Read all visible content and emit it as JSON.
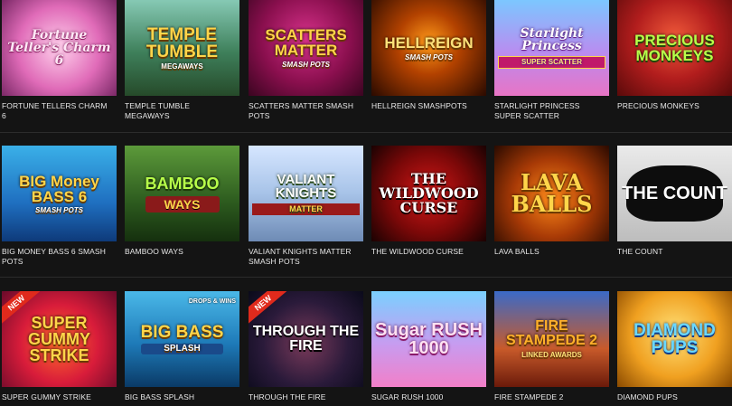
{
  "games": [
    {
      "caption": "FORTUNE TELLERS CHARM 6",
      "art": "Fortune Teller's Charm 6",
      "badge": ""
    },
    {
      "caption": "TEMPLE TUMBLE MEGAWAYS",
      "art": "TEMPLE TUMBLE",
      "art_sub": "MEGAWAYS",
      "badge": ""
    },
    {
      "caption": "SCATTERS MATTER SMASH POTS",
      "art": "SCATTERS MATTER",
      "art_sub": "SMASH POTS",
      "badge": ""
    },
    {
      "caption": "HELLREIGN SMASHPOTS",
      "art": "HELLREIGN",
      "art_sub": "SMASH POTS",
      "badge": ""
    },
    {
      "caption": "STARLIGHT PRINCESS SUPER SCATTER",
      "art": "Starlight Princess",
      "art_sub": "SUPER SCATTER",
      "badge": ""
    },
    {
      "caption": "PRECIOUS MONKEYS",
      "art": "PRECIOUS MONKEYS",
      "badge": ""
    },
    {
      "caption": "BIG MONEY BASS 6 SMASH POTS",
      "art": "BIG Money BASS 6",
      "art_sub": "SMASH POTS",
      "badge": ""
    },
    {
      "caption": "BAMBOO WAYS",
      "art": "BAMBOO",
      "art_sub": "WAYS",
      "badge": ""
    },
    {
      "caption": "VALIANT KNIGHTS MATTER SMASH POTS",
      "art": "VALIANT KNIGHTS",
      "art_sub": "MATTER",
      "badge": ""
    },
    {
      "caption": "THE WILDWOOD CURSE",
      "art": "THE WILDWOOD CURSE",
      "badge": ""
    },
    {
      "caption": "LAVA BALLS",
      "art": "LAVA BALLS",
      "badge": ""
    },
    {
      "caption": "THE COUNT",
      "art": "THE COUNT",
      "badge": ""
    },
    {
      "caption": "SUPER GUMMY STRIKE",
      "art": "SUPER GUMMY STRIKE",
      "badge": "NEW"
    },
    {
      "caption": "BIG BASS SPLASH",
      "art": "BIG BASS",
      "art_sub": "SPLASH",
      "badge": "DROPS & WINS"
    },
    {
      "caption": "THROUGH THE FIRE",
      "art": "THROUGH THE FIRE",
      "badge": "NEW"
    },
    {
      "caption": "SUGAR RUSH 1000",
      "art": "Sugar RUSH 1000",
      "badge": ""
    },
    {
      "caption": "FIRE STAMPEDE 2",
      "art": "FIRE STAMPEDE 2",
      "art_sub": "LINKED AWARDS",
      "badge": ""
    },
    {
      "caption": "DIAMOND PUPS",
      "art": "DIAMOND PUPS",
      "badge": ""
    }
  ],
  "colors": {
    "page_bg": "#141414",
    "caption_text": "#e8e8e8",
    "new_badge": "#e02a1c"
  }
}
